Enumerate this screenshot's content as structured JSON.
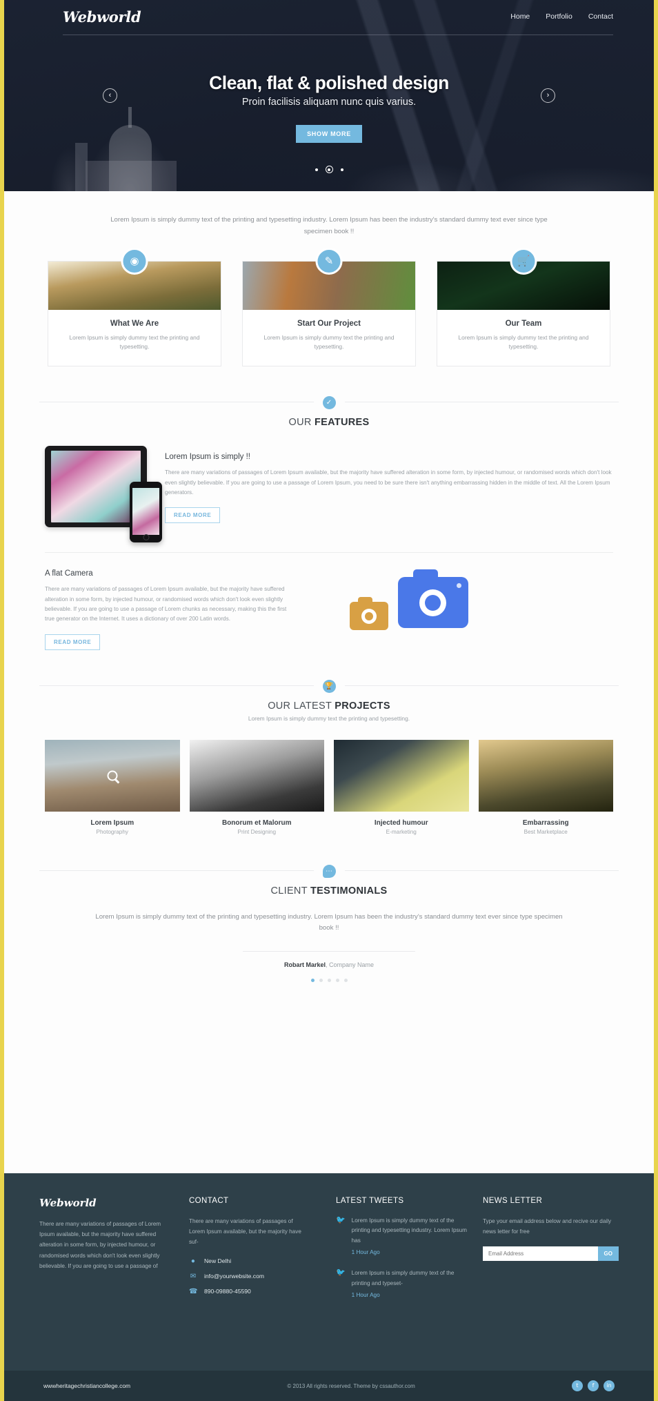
{
  "brand": {
    "name": "Webworld",
    "accent": "#74b9df",
    "dark": "#2e4049",
    "frame": "#e8d44d"
  },
  "nav": {
    "items": [
      "Home",
      "Portfolio",
      "Contact"
    ]
  },
  "hero": {
    "title": "Clean, flat & polished design",
    "subtitle": "Proin facilisis aliquam nunc quis varius.",
    "cta": "SHOW MORE",
    "prev_icon": "chevron-left-icon",
    "next_icon": "chevron-right-icon",
    "slide_count": 3,
    "active_slide": 2
  },
  "intro": {
    "text": "Lorem Ipsum is simply dummy text of the printing and typesetting industry. Lorem Ipsum has been the industry's standard dummy text ever since type specimen book !!"
  },
  "services": [
    {
      "icon": "camera-icon",
      "title": "What We Are",
      "text": "Lorem Ipsum is simply dummy text the printing and typesetting."
    },
    {
      "icon": "pencil-square-icon",
      "title": "Start Our Project",
      "text": "Lorem Ipsum is simply dummy text the printing and typesetting."
    },
    {
      "icon": "shopping-cart-icon",
      "title": "Our Team",
      "text": "Lorem Ipsum is simply dummy text the printing and typesetting."
    }
  ],
  "features": {
    "badge_icon": "check-circle-icon",
    "title_light": "OUR ",
    "title_bold": "FEATURES",
    "item": {
      "heading": "Lorem Ipsum is simply !!",
      "body": "There are many variations of passages of Lorem Ipsum available, but the majority have suffered alteration in some form, by injected humour, or randomised words which don't look even slightly believable. If you are going to use a passage of Lorem Ipsum, you need to be sure there isn't anything embarrassing hidden in the middle of text. All the Lorem Ipsum generators.",
      "cta": "READ MORE"
    }
  },
  "camera": {
    "heading": "A flat Camera",
    "body": "There are many variations of passages of Lorem Ipsum available, but the majority have suffered alteration in some form, by injected humour, or randomised words which don't look even slightly believable. If you are going to use a passage of Lorem chunks as necessary, making this the first true generator on the Internet. It uses a dictionary of over 200 Latin words.",
    "cta": "READ MORE"
  },
  "projects": {
    "badge_icon": "trophy-icon",
    "title_light": "OUR LATEST ",
    "title_bold": "PROJECTS",
    "subtitle": "Lorem Ipsum is simply dummy text the printing and typesetting.",
    "items": [
      {
        "title": "Lorem Ipsum",
        "category": "Photography",
        "overlay_icon": "magnifier-icon"
      },
      {
        "title": "Bonorum et Malorum",
        "category": "Print Designing"
      },
      {
        "title": "Injected humour",
        "category": "E-marketing"
      },
      {
        "title": "Embarrassing",
        "category": "Best Marketplace"
      }
    ]
  },
  "testimonials": {
    "badge_icon": "speech-bubble-icon",
    "title_light": "CLIENT ",
    "title_bold": "TESTIMONIALS",
    "quote": "Lorem Ipsum is simply dummy text of the printing and typesetting industry. Lorem Ipsum has been the industry's standard dummy text ever since type specimen book !!",
    "author_name": "Robart Markel",
    "author_company": ", Company Name",
    "dot_count": 5,
    "active_dot": 1
  },
  "footer": {
    "about": {
      "logo": "Webworld",
      "text": "There are many variations of passages of Lorem Ipsum available, but the majority have suffered alteration in some form, by injected humour, or randomised words which don't look even slightly believable. If you are going to use a passage of"
    },
    "contact": {
      "heading": "CONTACT",
      "text": "There are many variations of passages of Lorem Ipsum available, but the majority have suf-",
      "location_icon": "map-pin-icon",
      "location": "New Delhi",
      "email_icon": "envelope-icon",
      "email": "info@yourwebsite.com",
      "phone_icon": "phone-icon",
      "phone": "890-09880-45590"
    },
    "tweets": {
      "heading": "LATEST TWEETS",
      "items": [
        {
          "icon": "twitter-bird-icon",
          "text": "Lorem Ipsum is simply dummy text of the printing and typesetting industry. Lorem Ipsum has",
          "time": "1 Hour Ago"
        },
        {
          "icon": "twitter-bird-icon",
          "text": "Lorem Ipsum is simply dummy text of the printing and typeset-",
          "time": "1 Hour Ago"
        }
      ]
    },
    "newsletter": {
      "heading": "NEWS LETTER",
      "text": "Type your email address below and recive our daily news letter for free",
      "placeholder": "Email Address",
      "button": "GO"
    },
    "bar": {
      "site": "wwwheritagechristiancollege.com",
      "copyright": "© 2013 All rights reserved. Theme by cssauthor.com",
      "socials": [
        "twitter-icon",
        "facebook-icon",
        "linkedin-icon"
      ],
      "social_glyphs": [
        "t",
        "f",
        "in"
      ]
    }
  }
}
